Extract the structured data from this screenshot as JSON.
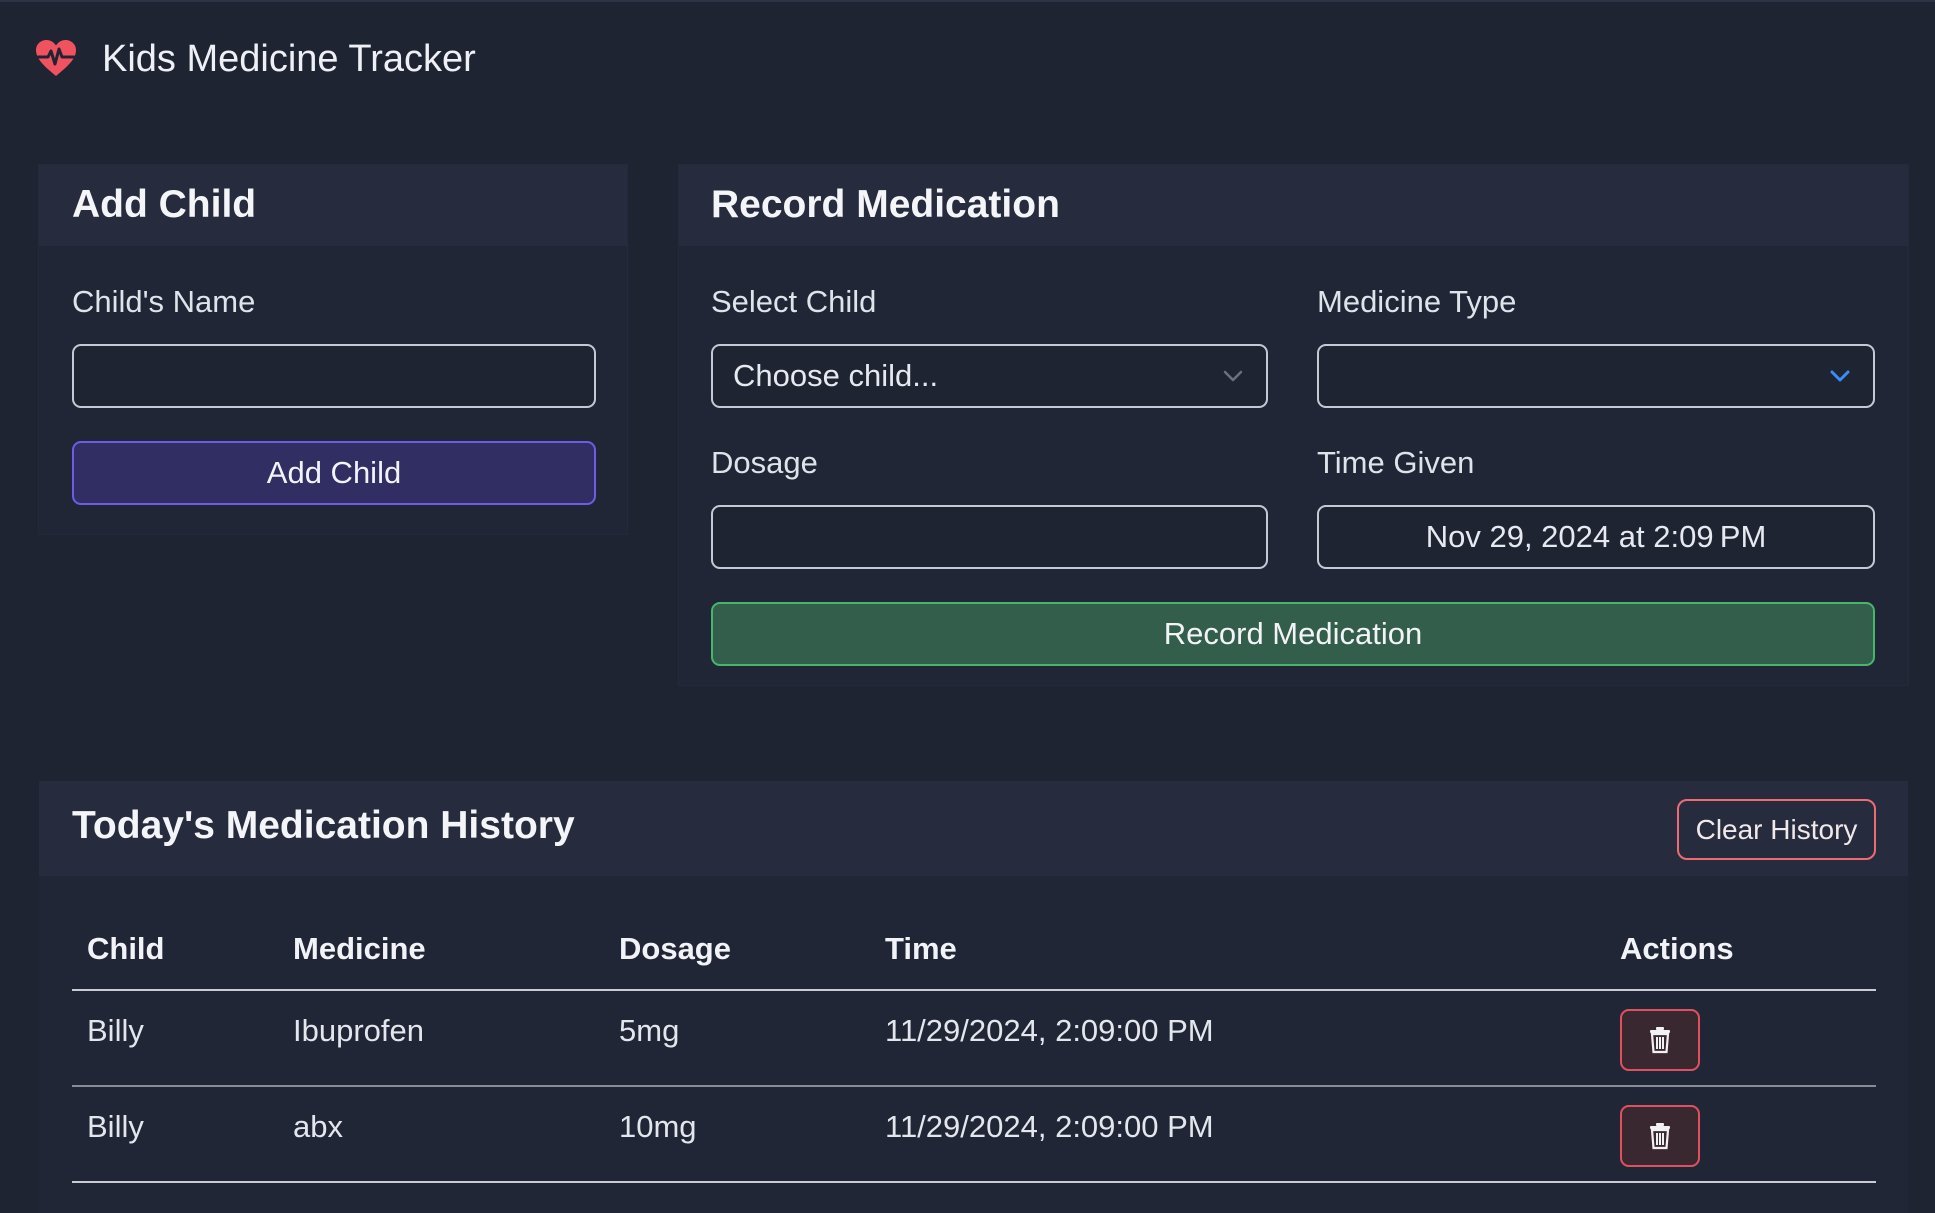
{
  "app": {
    "title": "Kids Medicine Tracker",
    "brand_icon": "heart-pulse-icon",
    "accent_color": "#f0525f"
  },
  "add_child": {
    "title": "Add Child",
    "name_label": "Child's Name",
    "name_value": "",
    "button_label": "Add Child"
  },
  "record": {
    "title": "Record Medication",
    "child_label": "Select Child",
    "child_value": "Choose child...",
    "medicine_label": "Medicine Type",
    "medicine_value": "",
    "dosage_label": "Dosage",
    "dosage_value": "",
    "time_label": "Time Given",
    "time_value": "Nov 29, 2024 at 2:09 PM",
    "button_label": "Record Medication"
  },
  "history": {
    "title": "Today's Medication History",
    "clear_label": "Clear History",
    "columns": [
      "Child",
      "Medicine",
      "Dosage",
      "Time",
      "Actions"
    ],
    "rows": [
      {
        "child": "Billy",
        "medicine": "Ibuprofen",
        "dosage": "5mg",
        "time": "11/29/2024, 2:09:00 PM",
        "action_icon": "trash-icon"
      },
      {
        "child": "Billy",
        "medicine": "abx",
        "dosage": "10mg",
        "time": "11/29/2024, 2:09:00 PM",
        "action_icon": "trash-icon"
      }
    ]
  },
  "colors": {
    "background": "#1f2433",
    "card_header": "#262c3d",
    "purple_button": "#302e63",
    "green_button": "#335e4b",
    "danger": "#e0505f"
  }
}
